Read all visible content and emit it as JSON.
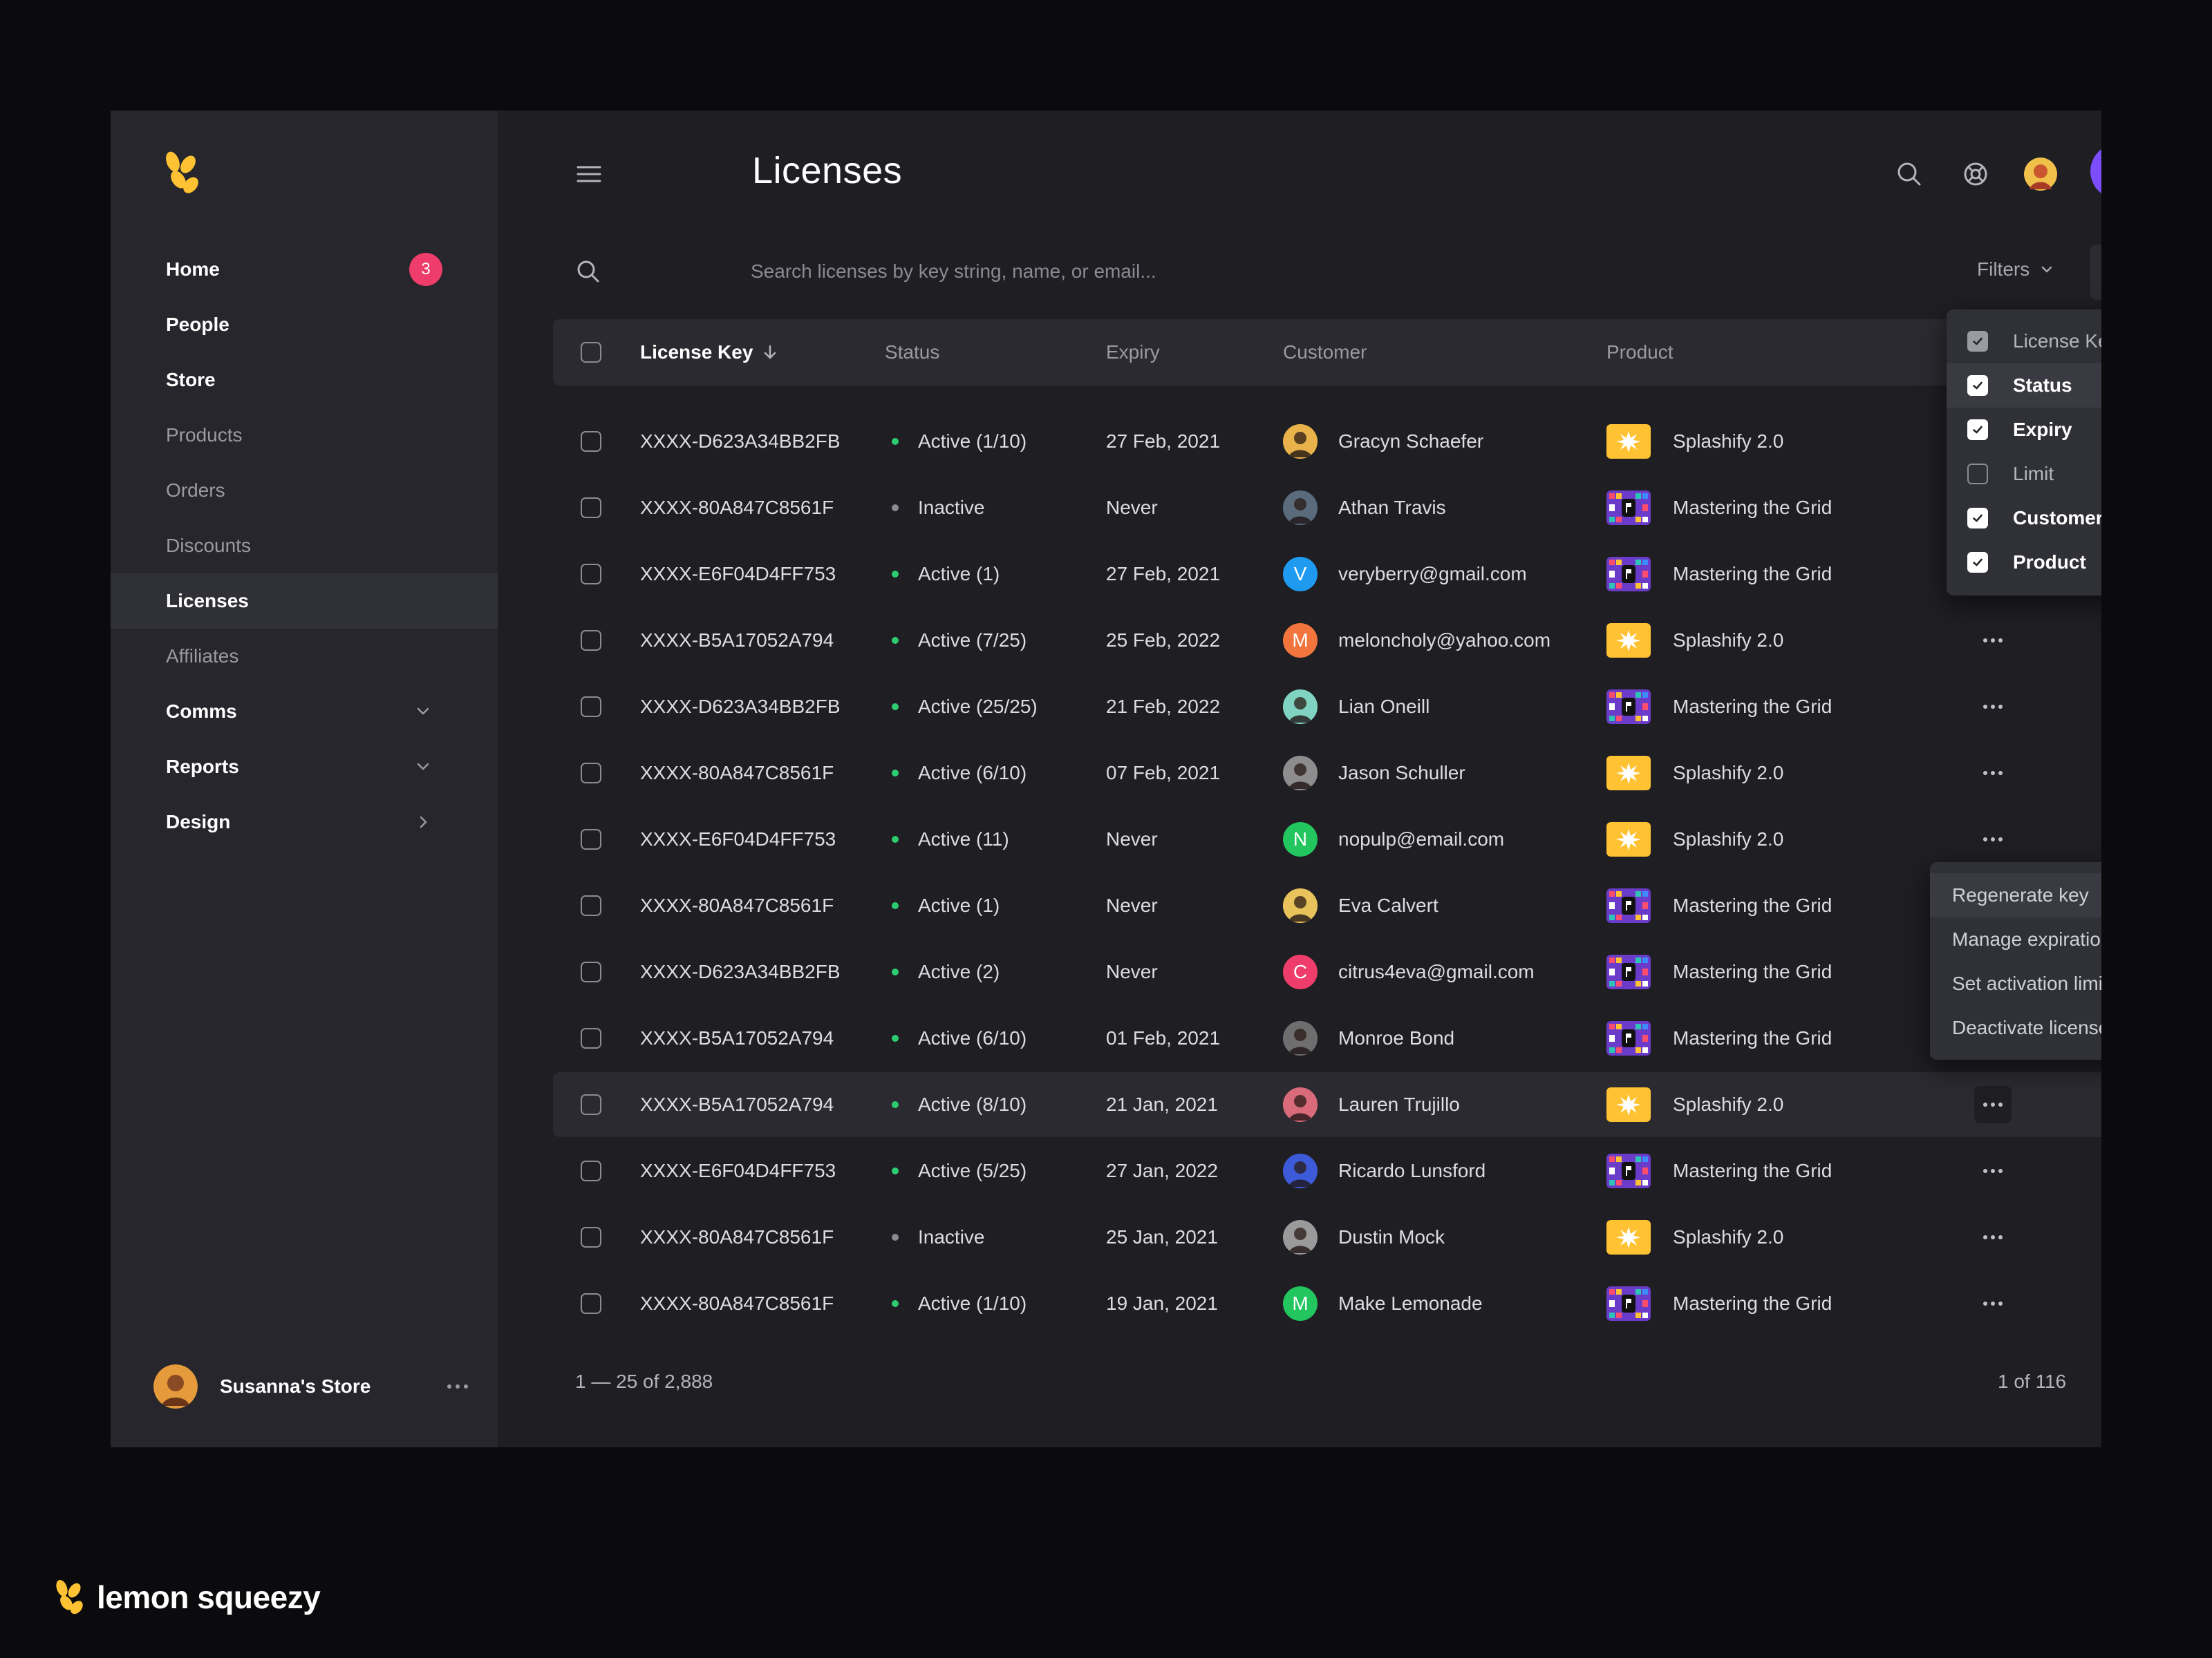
{
  "app": {
    "title": "Licenses"
  },
  "colors": {
    "accent": "#7c4dff",
    "badge": "#ee3d6a",
    "active": "#2ecc71",
    "inactive": "#8a8a93",
    "brand_yellow": "#ffc233"
  },
  "sidebar": {
    "logo_icon": "lemon-squeezy-logo-icon",
    "items": [
      {
        "label": "Home",
        "badge": "3"
      },
      {
        "label": "People"
      },
      {
        "label": "Store"
      },
      {
        "label": "Products"
      },
      {
        "label": "Orders"
      },
      {
        "label": "Discounts"
      },
      {
        "label": "Licenses"
      },
      {
        "label": "Affiliates"
      },
      {
        "label": "Comms",
        "icon": "chevron-down-icon"
      },
      {
        "label": "Reports",
        "icon": "chevron-down-icon"
      },
      {
        "label": "Design",
        "icon": "chevron-right-icon"
      }
    ],
    "store_name": "Susanna's Store"
  },
  "header": {
    "title": "Licenses",
    "icons": [
      "menu-icon",
      "search-icon",
      "help-icon",
      "avatar",
      "plus-icon"
    ]
  },
  "search": {
    "placeholder": "Search licenses by key string, name, or email...",
    "value": "",
    "filters_label": "Filters"
  },
  "table": {
    "columns": [
      "License Key",
      "Status",
      "Expiry",
      "Customer",
      "Product"
    ],
    "rows": [
      {
        "key": "XXXX-D623A34BB2FB",
        "status": "Active (1/10)",
        "active": true,
        "expiry": "27 Feb, 2021",
        "customer": "Gracyn Schaefer",
        "avatar_color": "#e9b24a",
        "product": "Splashify 2.0",
        "product_type": "splashify"
      },
      {
        "key": "XXXX-80A847C8561F",
        "status": "Inactive",
        "active": false,
        "expiry": "Never",
        "customer": "Athan Travis",
        "avatar_color": "#5a6b7c",
        "product": "Mastering the Grid",
        "product_type": "grid"
      },
      {
        "key": "XXXX-E6F04D4FF753",
        "status": "Active (1)",
        "active": true,
        "expiry": "27 Feb, 2021",
        "customer": "veryberry@gmail.com",
        "avatar_letter": "V",
        "avatar_color": "#1e9bf0",
        "product": "Mastering the Grid",
        "product_type": "grid"
      },
      {
        "key": "XXXX-B5A17052A794",
        "status": "Active (7/25)",
        "active": true,
        "expiry": "25 Feb, 2022",
        "customer": "meloncholy@yahoo.com",
        "avatar_letter": "M",
        "avatar_color": "#f2753d",
        "product": "Splashify 2.0",
        "product_type": "splashify"
      },
      {
        "key": "XXXX-D623A34BB2FB",
        "status": "Active (25/25)",
        "active": true,
        "expiry": "21 Feb, 2022",
        "customer": "Lian Oneill",
        "avatar_color": "#7fd3c0",
        "product": "Mastering the Grid",
        "product_type": "grid"
      },
      {
        "key": "XXXX-80A847C8561F",
        "status": "Active (6/10)",
        "active": true,
        "expiry": "07 Feb, 2021",
        "customer": "Jason Schuller",
        "avatar_color": "#8d8d8d",
        "product": "Splashify 2.0",
        "product_type": "splashify"
      },
      {
        "key": "XXXX-E6F04D4FF753",
        "status": "Active (11)",
        "active": true,
        "expiry": "Never",
        "customer": "nopulp@email.com",
        "avatar_letter": "N",
        "avatar_color": "#22c55e",
        "product": "Splashify 2.0",
        "product_type": "splashify"
      },
      {
        "key": "XXXX-80A847C8561F",
        "status": "Active (1)",
        "active": true,
        "expiry": "Never",
        "customer": "Eva Calvert",
        "avatar_color": "#e8c25a",
        "product": "Mastering the Grid",
        "product_type": "grid"
      },
      {
        "key": "XXXX-D623A34BB2FB",
        "status": "Active (2)",
        "active": true,
        "expiry": "Never",
        "customer": "citrus4eva@gmail.com",
        "avatar_letter": "C",
        "avatar_color": "#ee3d6a",
        "product": "Mastering the Grid",
        "product_type": "grid"
      },
      {
        "key": "XXXX-B5A17052A794",
        "status": "Active (6/10)",
        "active": true,
        "expiry": "01 Feb, 2021",
        "customer": "Monroe Bond",
        "avatar_color": "#6e6e6e",
        "product": "Mastering the Grid",
        "product_type": "grid"
      },
      {
        "key": "XXXX-B5A17052A794",
        "status": "Active (8/10)",
        "active": true,
        "expiry": "21 Jan, 2021",
        "customer": "Lauren Trujillo",
        "avatar_color": "#d96a7a",
        "product": "Splashify 2.0",
        "product_type": "splashify"
      },
      {
        "key": "XXXX-E6F04D4FF753",
        "status": "Active (5/25)",
        "active": true,
        "expiry": "27 Jan, 2022",
        "customer": "Ricardo Lunsford",
        "avatar_color": "#3d5bd9",
        "product": "Mastering the Grid",
        "product_type": "grid"
      },
      {
        "key": "XXXX-80A847C8561F",
        "status": "Inactive",
        "active": false,
        "expiry": "25 Jan, 2021",
        "customer": "Dustin Mock",
        "avatar_color": "#9a9a9a",
        "product": "Splashify 2.0",
        "product_type": "splashify"
      },
      {
        "key": "XXXX-80A847C8561F",
        "status": "Active (1/10)",
        "active": true,
        "expiry": "19 Jan, 2021",
        "customer": "Make Lemonade",
        "avatar_letter": "M",
        "avatar_color": "#22c55e",
        "product": "Mastering the Grid",
        "product_type": "grid"
      }
    ]
  },
  "column_menu": {
    "items": [
      {
        "label": "License Key",
        "checked": true,
        "disabled": true
      },
      {
        "label": "Status",
        "checked": true
      },
      {
        "label": "Expiry",
        "checked": true
      },
      {
        "label": "Limit",
        "checked": false
      },
      {
        "label": "Customer",
        "checked": true
      },
      {
        "label": "Product",
        "checked": true
      }
    ]
  },
  "row_actions": {
    "items": [
      "Regenerate key",
      "Manage expiration",
      "Set activation limit",
      "Deactivate license"
    ]
  },
  "pagination": {
    "range": "1 — 25 of 2,888",
    "page": "1 of 116"
  },
  "brand": {
    "name": "lemon squeezy"
  }
}
